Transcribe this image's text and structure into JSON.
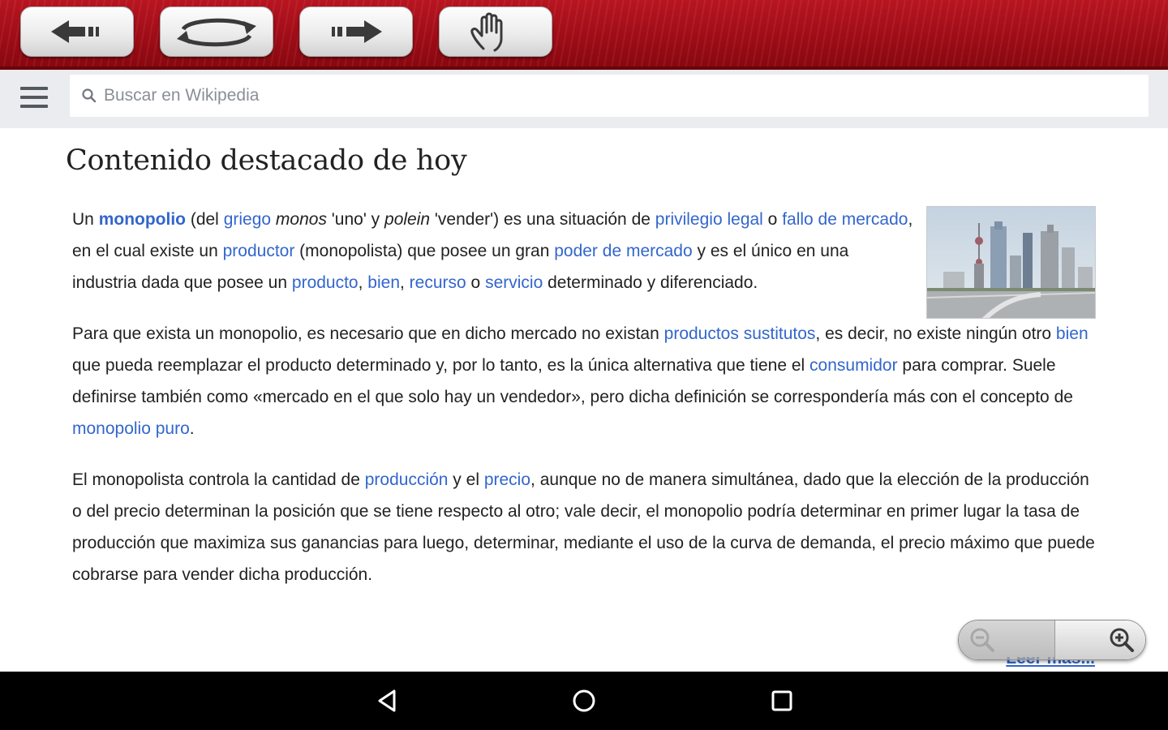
{
  "toolbar": {
    "buttons": [
      {
        "name": "back",
        "icon": "arrow-left-icon"
      },
      {
        "name": "refresh",
        "icon": "refresh-icon"
      },
      {
        "name": "forward",
        "icon": "arrow-right-icon"
      },
      {
        "name": "pan",
        "icon": "hand-icon"
      }
    ],
    "accent": "#a30f19"
  },
  "search": {
    "placeholder": "Buscar en Wikipedia",
    "menu_icon": "hamburger-menu-icon",
    "search_icon": "search-icon"
  },
  "main": {
    "heading": "Contenido destacado de hoy",
    "p1": {
      "t1": "Un ",
      "l1": "monopolio",
      "t2": " (del ",
      "l2": "griego",
      "t3": " ",
      "i1": "monos",
      "t4": " 'uno' y ",
      "i2": "polein",
      "t5": " 'vender') es una situación de ",
      "l3": "privilegio legal",
      "t6": " o ",
      "l4": "fallo de mercado",
      "t7": ", en el cual existe un ",
      "l5": "productor",
      "t8": " (monopolista) que posee un gran ",
      "l6": "poder de mercado",
      "t9": " y es el único en una industria dada que posee un ",
      "l7": "producto",
      "t10": ", ",
      "l8": "bien",
      "t11": ", ",
      "l9": "recurso",
      "t12": " o ",
      "l10": "servicio",
      "t13": " determinado y diferenciado."
    },
    "p2": {
      "t1": "Para que exista un monopolio, es necesario que en dicho mercado no existan ",
      "l1": "productos sustitutos",
      "t2": ", es decir, no existe ningún otro ",
      "l2": "bien",
      "t3": " que pueda reemplazar el producto determinado y, por lo tanto, es la única alternativa que tiene el ",
      "l3": "consumidor",
      "t4": " para comprar. Suele definirse también como «mercado en el que solo hay un vendedor», pero dicha definición se correspondería más con el concepto de ",
      "l4": "monopolio puro",
      "t5": "."
    },
    "p3": {
      "t1": "El monopolista controla la cantidad de ",
      "l1": "producción",
      "t2": " y el ",
      "l2": "precio",
      "t3": ", aunque no de manera simultánea, dado que la elección de la producción o del precio determinan la posición que se tiene respecto al otro; vale decir, el monopolio podría determinar en primer lugar la tasa de producción que maximiza sus ganancias para luego, determinar, mediante el uso de la curva de demanda, el precio máximo que puede cobrarse para vender dicha producción."
    },
    "read_more": "Leer más...",
    "link_color": "#3366cc"
  },
  "zoom": {
    "out_icon": "zoom-out-icon",
    "in_icon": "zoom-in-icon"
  },
  "navbar": {
    "back_icon": "nav-back-icon",
    "home_icon": "nav-home-icon",
    "recents_icon": "nav-recents-icon"
  }
}
